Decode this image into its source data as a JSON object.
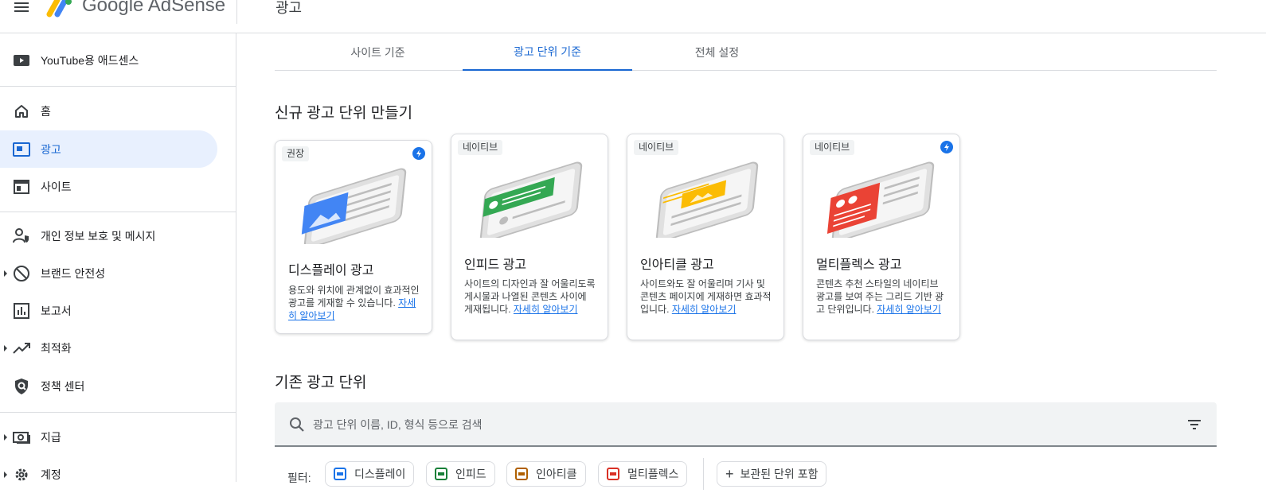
{
  "header": {
    "brand": "Google AdSense",
    "page_title": "광고"
  },
  "sidebar": {
    "items": [
      {
        "label": "YouTube용 애드센스",
        "icon": "youtube-icon"
      },
      {
        "label": "홈",
        "icon": "home-icon"
      },
      {
        "label": "광고",
        "icon": "ads-icon",
        "active": true
      },
      {
        "label": "사이트",
        "icon": "sites-icon"
      },
      {
        "label": "개인 정보 보호 및 메시지",
        "icon": "privacy-person-icon"
      },
      {
        "label": "브랜드 안전성",
        "icon": "block-icon"
      },
      {
        "label": "보고서",
        "icon": "reports-icon"
      },
      {
        "label": "최적화",
        "icon": "trending-icon"
      },
      {
        "label": "정책 센터",
        "icon": "policy-shield-icon"
      },
      {
        "label": "지급",
        "icon": "payments-icon"
      },
      {
        "label": "계정",
        "icon": "gear-icon"
      }
    ]
  },
  "tabs": [
    {
      "label": "사이트 기준"
    },
    {
      "label": "광고 단위 기준",
      "active": true
    },
    {
      "label": "전체 설정"
    }
  ],
  "new_section": {
    "title": "신규 광고 단위 만들기"
  },
  "cards": [
    {
      "badge": "권장",
      "title": "디스플레이 광고",
      "desc": "용도와 위치에 관계없이 효과적인 광고를 게재할 수 있습니다.",
      "link": "자세히 알아보기",
      "accent": "#4285f4",
      "bolt": true
    },
    {
      "badge": "네이티브",
      "title": "인피드 광고",
      "desc": "사이트의 디자인과 잘 어울리도록 게시물과 나열된 콘텐츠 사이에 게재됩니다.",
      "link": "자세히 알아보기",
      "accent": "#34a853",
      "bolt": false
    },
    {
      "badge": "네이티브",
      "title": "인아티클 광고",
      "desc": "사이트와도 잘 어울리며 기사 및 콘텐츠 페이지에 게재하면 효과적입니다.",
      "link": "자세히 알아보기",
      "accent": "#fbbc04",
      "bolt": false
    },
    {
      "badge": "네이티브",
      "title": "멀티플렉스 광고",
      "desc": "콘텐츠 추천 스타일의 네이티브 광고를 보여 주는 그리드 기반 광고 단위입니다.",
      "link": "자세히 알아보기",
      "accent": "#ea4335",
      "bolt": true
    }
  ],
  "existing_section": {
    "title": "기존 광고 단위"
  },
  "search": {
    "placeholder": "광고 단위 이름, ID, 형식 등으로 검색"
  },
  "filters": {
    "label": "필터:",
    "chips": [
      {
        "label": "디스플레이",
        "color": "#1a73e8"
      },
      {
        "label": "인피드",
        "color": "#188038"
      },
      {
        "label": "인아티클",
        "color": "#b06000"
      },
      {
        "label": "멀티플렉스",
        "color": "#d93025"
      }
    ],
    "archived": "보관된 단위 포함"
  }
}
